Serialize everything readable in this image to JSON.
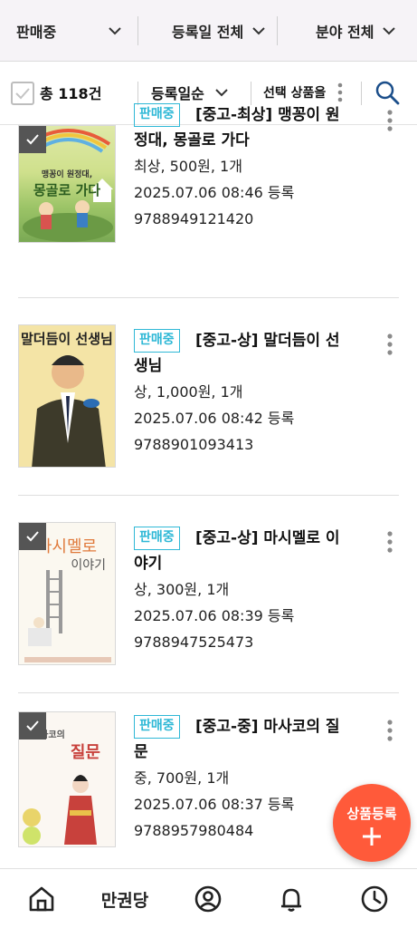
{
  "filters": {
    "status_label": "판매중",
    "date_label": "등록일 전체",
    "category_label": "분야 전체"
  },
  "toolbar": {
    "total_label": "총 118건",
    "sort_label": "등록일순",
    "selected_action_label": "선택 상품을"
  },
  "items": [
    {
      "badge": "판매중",
      "title": "[중고-최상] 맹꽁이 원정대, 몽골로 가다",
      "detail": "최상, 500원, 1개",
      "registered": "2025.07.06 08:46 등록",
      "isbn": "9788949121420",
      "cover_text": "맹꽁이 원정대, 몽골로 가다"
    },
    {
      "badge": "판매중",
      "title": "[중고-상] 말더듬이 선생님",
      "detail": "상, 1,000원, 1개",
      "registered": "2025.07.06 08:42 등록",
      "isbn": "9788901093413",
      "cover_text": "말더듬이 선생님"
    },
    {
      "badge": "판매중",
      "title": "[중고-상] 마시멜로 이야기",
      "detail": "상, 300원, 1개",
      "registered": "2025.07.06 08:39 등록",
      "isbn": "9788947525473",
      "cover_text": "마시멜로 이야기"
    },
    {
      "badge": "판매중",
      "title": "[중고-중] 마사코의 질문",
      "detail": "중, 700원, 1개",
      "registered": "2025.07.06 08:37 등록",
      "isbn": "9788957980484",
      "cover_text": "마사코의 질문"
    }
  ],
  "fab": {
    "label": "상품등록"
  },
  "nav": {
    "brand": "만권당"
  },
  "colors": {
    "accent": "#2fb8d6",
    "fab": "#ff5a3a"
  },
  "icons": [
    "chevron-down-icon",
    "checkbox-icon",
    "kebab-icon",
    "search-icon",
    "plus-icon",
    "home-icon",
    "profile-icon",
    "bell-icon",
    "clock-icon"
  ]
}
